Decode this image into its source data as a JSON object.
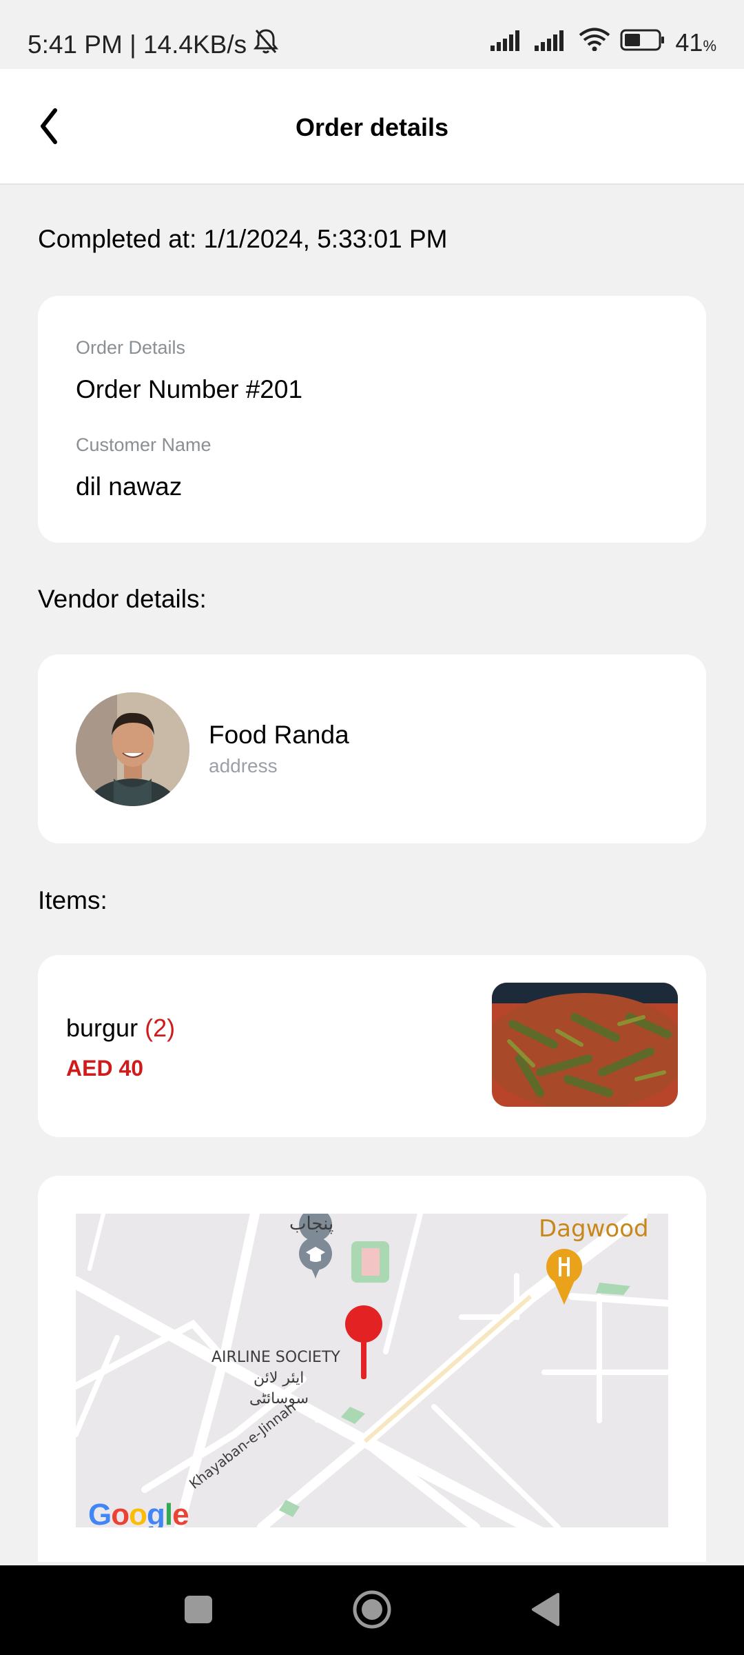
{
  "status_bar": {
    "time_speed": "5:41 PM | 14.4KB/s",
    "battery": "41",
    "battery_unit": "%"
  },
  "appbar": {
    "title": "Order details"
  },
  "completed_at": "Completed at: 1/1/2024, 5:33:01 PM",
  "order": {
    "details_label": "Order Details",
    "order_number": "Order Number #201",
    "customer_label": "Customer Name",
    "customer_name": "dil nawaz"
  },
  "vendor": {
    "section_title": "Vendor details:",
    "name": "Food Randa",
    "address": "address"
  },
  "items": {
    "section_title": "Items:",
    "list": [
      {
        "name": "burgur",
        "qty": "(2)",
        "price": "AED 40"
      }
    ]
  },
  "map": {
    "labels": {
      "punjab": "پنجاب",
      "dagwood": "Dagwood",
      "airline_society": "AIRLINE SOCIETY",
      "airline_urdu_1": "ایئر لائن",
      "airline_urdu_2": "سوسائٹی",
      "road": "Khayaban-e-Jinnah"
    },
    "brand": "Google"
  },
  "colors": {
    "accent_red": "#d11a1a",
    "background": "#f1f1f1",
    "card": "#ffffff"
  },
  "icons": {
    "back": "chevron-left-icon",
    "nav_recent": "square-icon",
    "nav_home": "circle-icon",
    "nav_back": "triangle-icon"
  }
}
